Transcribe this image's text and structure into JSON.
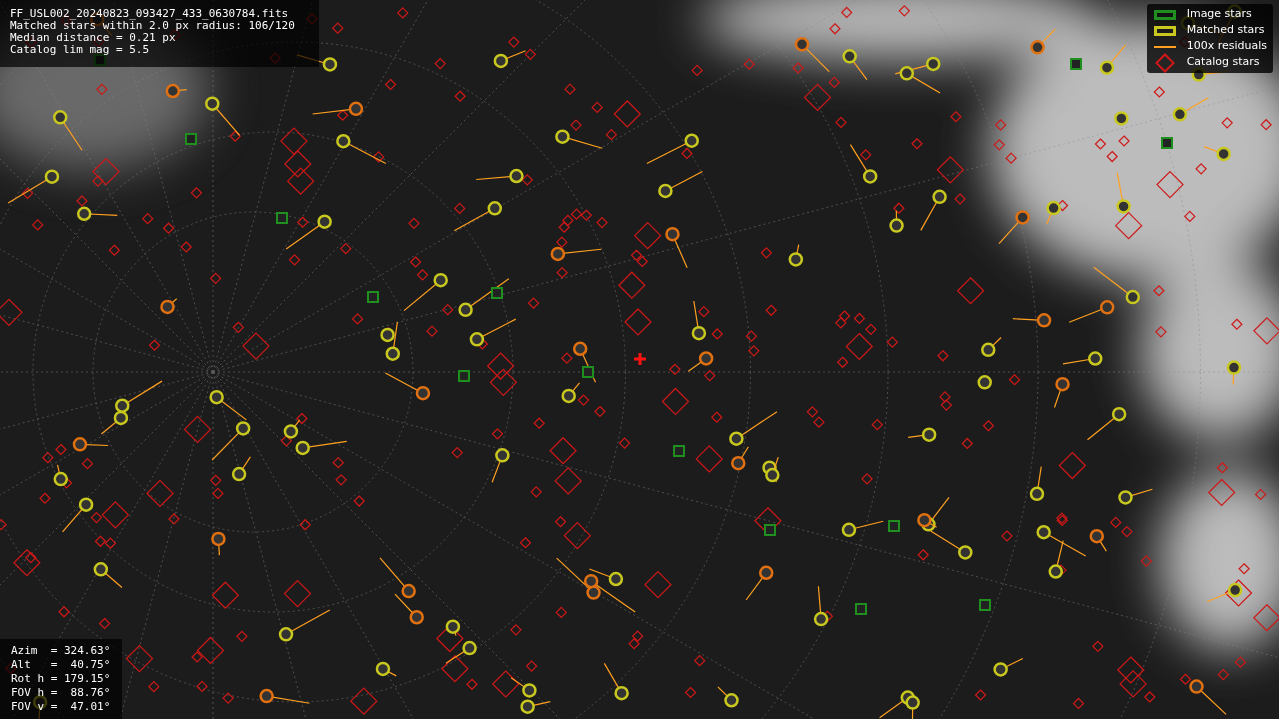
{
  "info_box": {
    "lines": [
      "FF_USL002_20240823_093427_433_0630784.fits",
      "Matched stars within 2.0 px radius: 106/120",
      "Median distance = 0.21 px",
      "Catalog lim mag = 5.5"
    ]
  },
  "legend": [
    {
      "kind": "box",
      "color": "#1f8f1f",
      "label": "Image stars"
    },
    {
      "kind": "box",
      "color": "#c8c81e",
      "label": "Matched stars"
    },
    {
      "kind": "line",
      "color": "#ffa020",
      "label": "100x residuals"
    },
    {
      "kind": "diamond",
      "color": "#d01818",
      "label": "Catalog stars"
    }
  ],
  "pointing": {
    "lines": [
      "Azim  = 324.63°",
      "Alt   =  40.75°",
      "Rot h = 179.15°",
      "FOV h =  88.76°",
      "FOV v =  47.01°"
    ]
  }
}
